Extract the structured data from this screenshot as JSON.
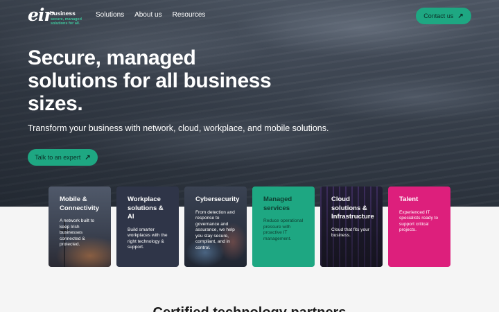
{
  "header": {
    "logo": {
      "mark": "eir",
      "business": "business",
      "tagline": "secure, managed solutions for all."
    },
    "nav": [
      "Solutions",
      "About us",
      "Resources"
    ],
    "contact_label": "Contact us"
  },
  "hero": {
    "title": "Secure, managed solutions for all business sizes.",
    "subtitle": "Transform your business with network, cloud, workplace, and mobile solutions.",
    "cta_label": "Talk to an expert"
  },
  "cards": [
    {
      "title": "Mobile & Connectivity",
      "desc": "A network built to keep Irish businesses connected & protected."
    },
    {
      "title": "Workplace solutions & AI",
      "desc": "Build smarter workplaces with the right technology & support."
    },
    {
      "title": "Cybersecurity",
      "desc": "From detection and response to governance and assurance, we help you stay secure, compliant, and in control."
    },
    {
      "title": "Managed services",
      "desc": "Reduce operational pressure with proactive IT management."
    },
    {
      "title": "Cloud solutions & Infrastructure",
      "desc": "Cloud that fits your business."
    },
    {
      "title": "Talent",
      "desc": "Experienced IT specialists ready to support critical projects."
    }
  ],
  "section": {
    "title": "Certified technology partners"
  },
  "colors": {
    "accent": "#1ea782",
    "talent": "#dd1f7c",
    "workplace": "#2f3548"
  }
}
